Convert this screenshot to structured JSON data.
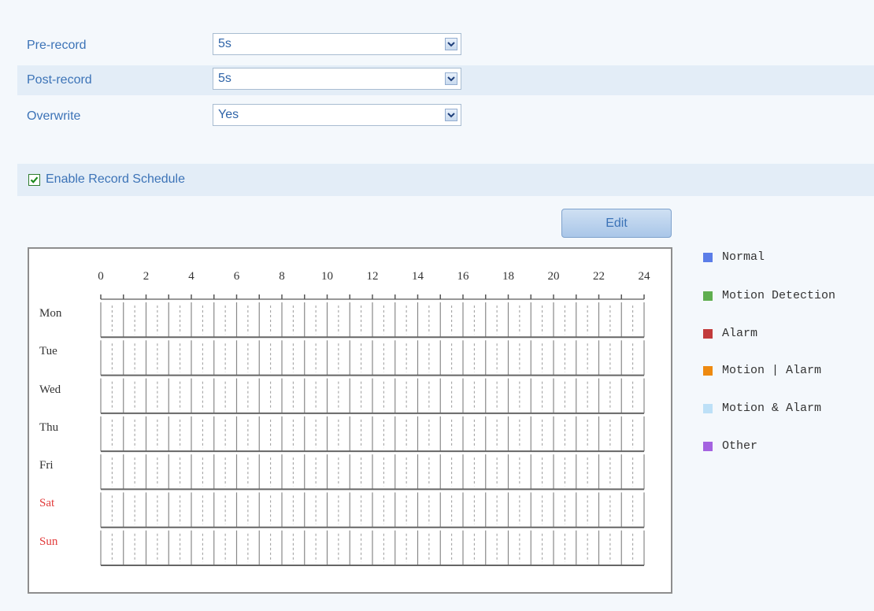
{
  "settings": {
    "pre_record": {
      "label": "Pre-record",
      "value": "5s"
    },
    "post_record": {
      "label": "Post-record",
      "value": "5s"
    },
    "overwrite": {
      "label": "Overwrite",
      "value": "Yes"
    }
  },
  "schedule": {
    "enable_label": "Enable Record Schedule",
    "enabled": true,
    "edit_label": "Edit",
    "hours": [
      "0",
      "2",
      "4",
      "6",
      "8",
      "10",
      "12",
      "14",
      "16",
      "18",
      "20",
      "22",
      "24"
    ],
    "days": [
      {
        "name": "Mon",
        "weekend": false
      },
      {
        "name": "Tue",
        "weekend": false
      },
      {
        "name": "Wed",
        "weekend": false
      },
      {
        "name": "Thu",
        "weekend": false
      },
      {
        "name": "Fri",
        "weekend": false
      },
      {
        "name": "Sat",
        "weekend": true
      },
      {
        "name": "Sun",
        "weekend": true
      }
    ]
  },
  "legend": [
    {
      "label": "Normal",
      "color": "#5b7de8"
    },
    {
      "label": "Motion Detection",
      "color": "#5fae4f"
    },
    {
      "label": "Alarm",
      "color": "#c23b3b"
    },
    {
      "label": "Motion | Alarm",
      "color": "#ee8a10"
    },
    {
      "label": "Motion & Alarm",
      "color": "#bde0f7"
    },
    {
      "label": "Other",
      "color": "#a463e0"
    }
  ]
}
